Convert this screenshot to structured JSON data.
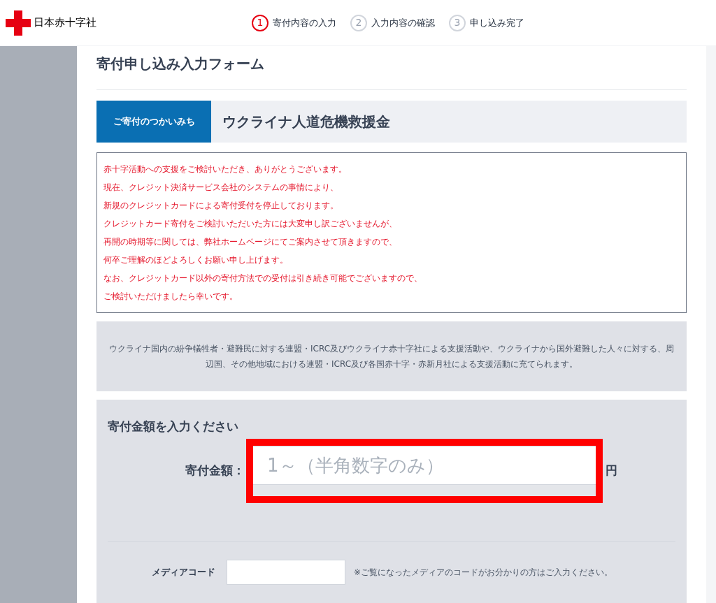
{
  "header": {
    "logo_text": "日本赤十字社",
    "steps": [
      {
        "number": "1",
        "label": "寄付内容の入力",
        "selected": true
      },
      {
        "number": "2",
        "label": "入力内容の確認",
        "selected": false
      },
      {
        "number": "3",
        "label": "申し込み完了",
        "selected": false
      }
    ]
  },
  "form": {
    "title": "寄付申し込み入力フォーム",
    "purpose": {
      "label": "ご寄付のつかいみち",
      "value": "ウクライナ人道危機救援金"
    },
    "notice_lines": [
      "赤十字活動への支援をご検討いただき、ありがとうございます。",
      "現在、クレジット決済サービス会社のシステムの事情により、",
      "新規のクレジットカードによる寄付受付を停止しております。",
      "クレジットカード寄付をご検討いただいた方には大変申し訳ございませんが、",
      "再開の時期等に関しては、弊社ホームページにてご案内させて頂きますので、",
      "何卒ご理解のほどよろしくお願い申し上げます。",
      "なお、クレジットカード以外の寄付方法での受付は引き続き可能でございますので、",
      "ご検討いただけましたら幸いです。"
    ],
    "description": "ウクライナ国内の紛争犠牲者・避難民に対する連盟・ICRC及びウクライナ赤十字社による支援活動や、ウクライナから国外避難した人々に対する、周辺国、その他地域における連盟・ICRC及び各国赤十字・赤新月社による支援活動に充てられます。",
    "amount_section": {
      "heading": "寄付金額を入力ください",
      "label": "寄付金額：",
      "placeholder": "1～（半角数字のみ）",
      "unit": "円",
      "highlighted": true
    },
    "media_code": {
      "label": "メディアコード",
      "note": "※ご覧になったメディアのコードがお分かりの方はご入力ください。"
    }
  }
}
